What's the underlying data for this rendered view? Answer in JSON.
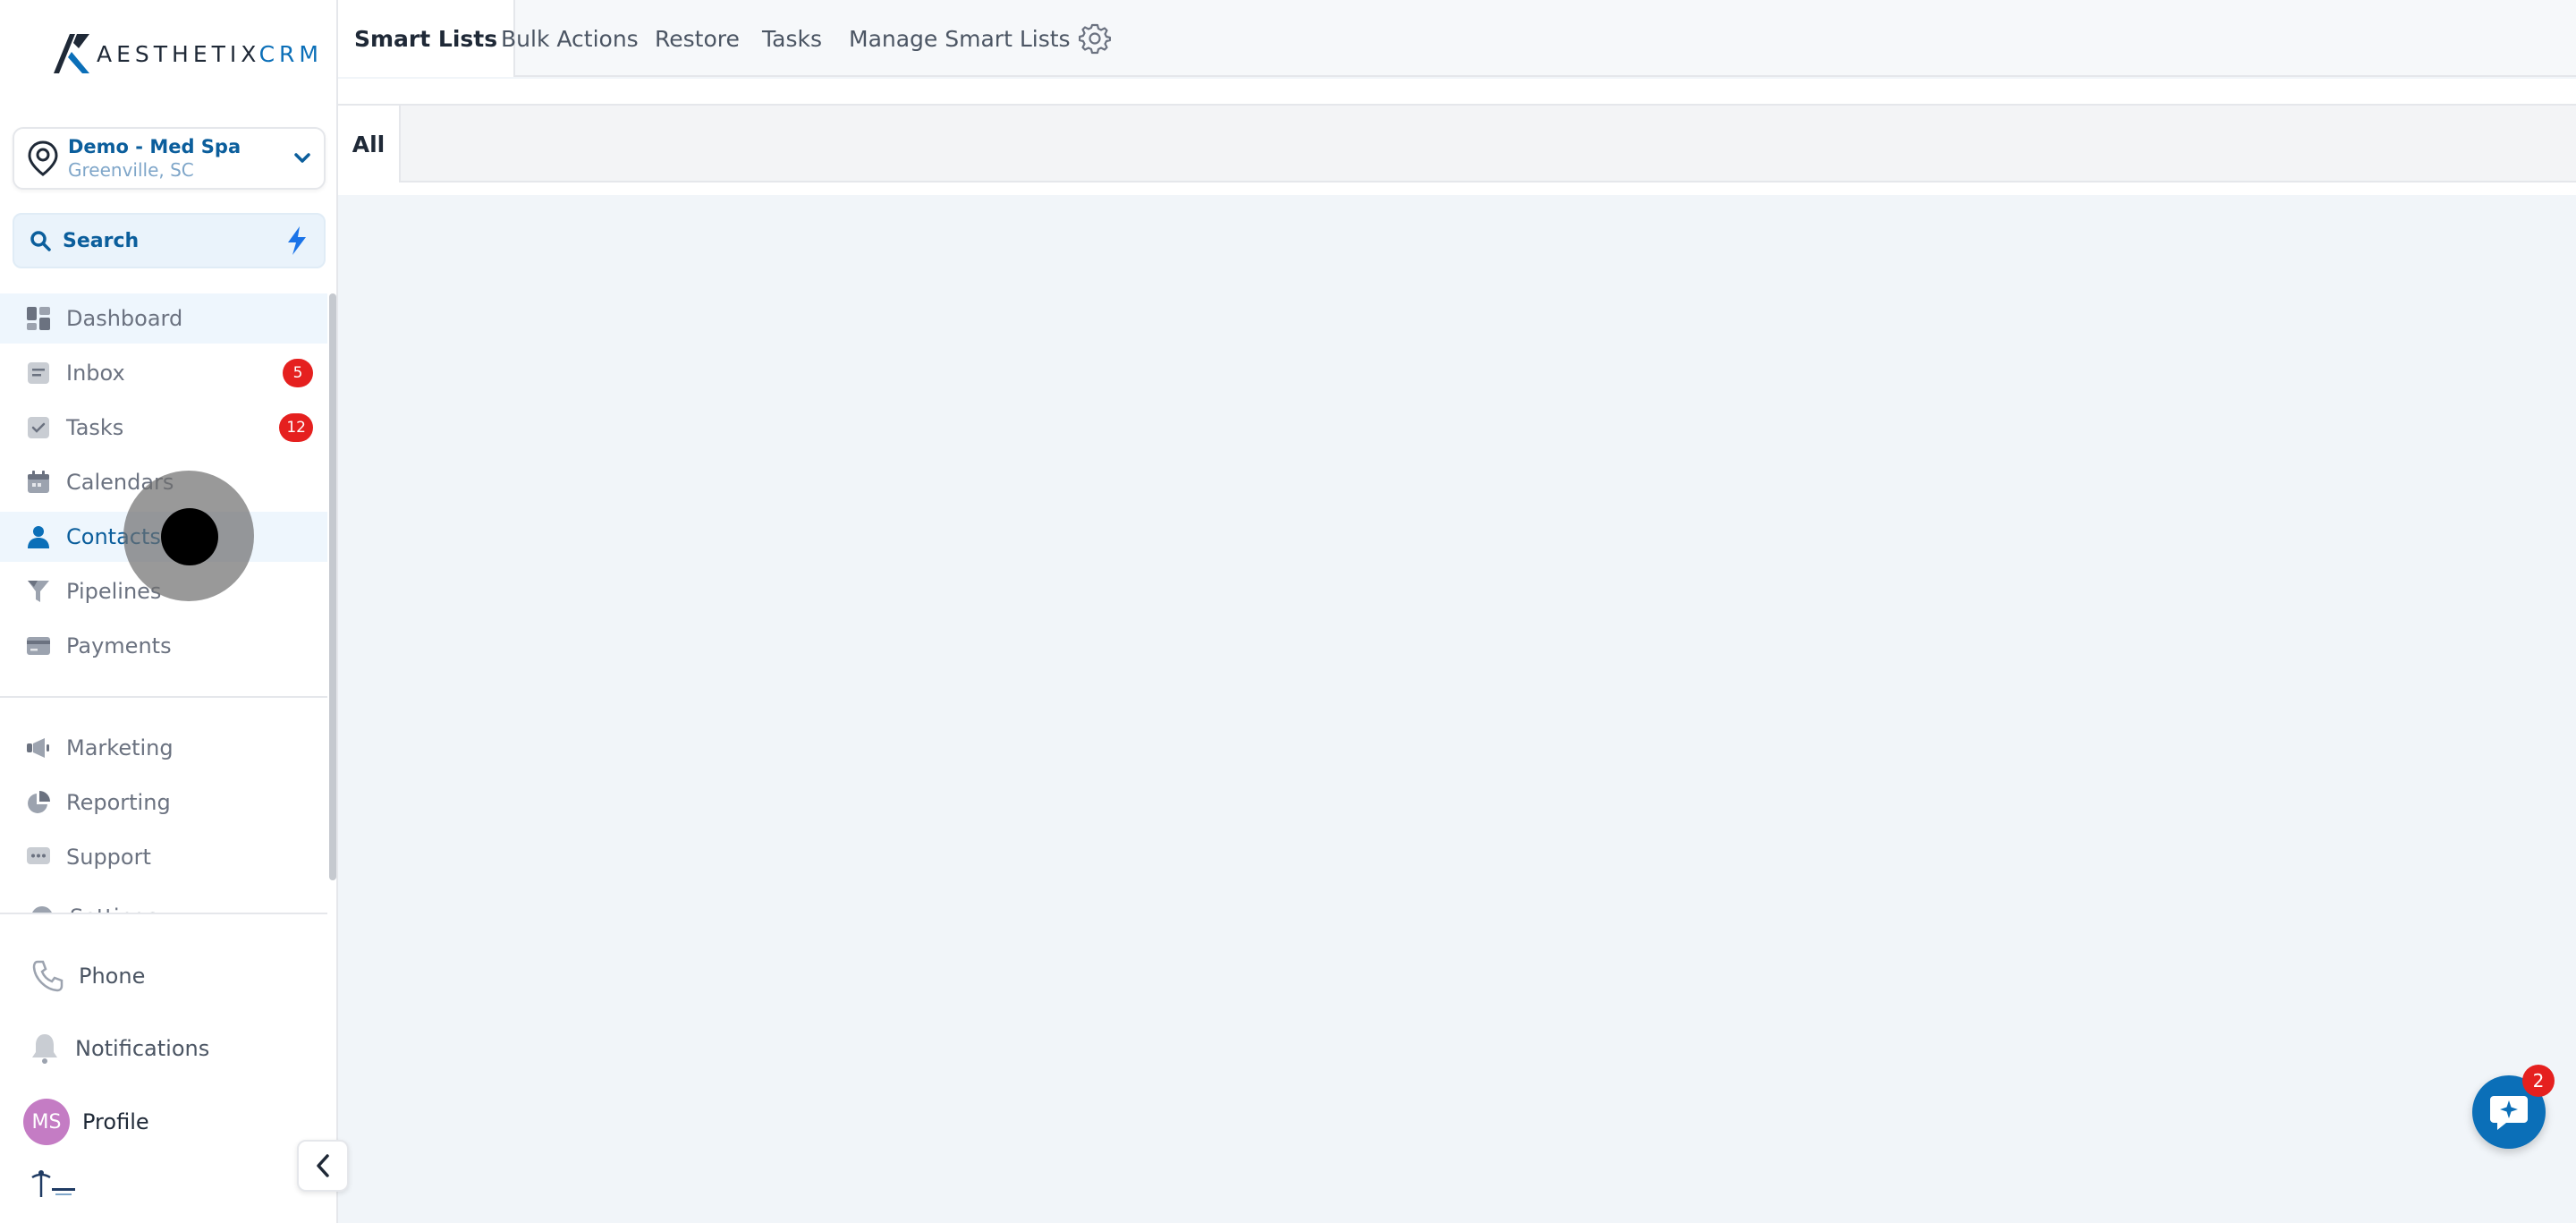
{
  "brand": {
    "logo_main": "AESTHETIX",
    "logo_accent": "CRM",
    "accent_color": "#0b6fb8"
  },
  "location": {
    "name": "Demo - Med Spa",
    "city": "Greenville, SC"
  },
  "search": {
    "label": "Search"
  },
  "nav": {
    "dashboard": "Dashboard",
    "inbox": "Inbox",
    "inbox_badge": "5",
    "tasks": "Tasks",
    "tasks_badge": "12",
    "calendars": "Calendars",
    "contacts": "Contacts",
    "pipelines": "Pipelines",
    "payments": "Payments",
    "marketing": "Marketing",
    "reporting": "Reporting",
    "support": "Support",
    "settings": "Settings"
  },
  "bottom": {
    "phone": "Phone",
    "notifications": "Notifications",
    "avatar_initials": "MS",
    "profile": "Profile"
  },
  "tabs": {
    "smart_lists": "Smart Lists",
    "bulk_actions": "Bulk Actions",
    "restore": "Restore",
    "tasks": "Tasks",
    "manage_smart_lists": "Manage Smart Lists"
  },
  "subtabs": {
    "all": "All"
  },
  "chat": {
    "badge": "2"
  }
}
